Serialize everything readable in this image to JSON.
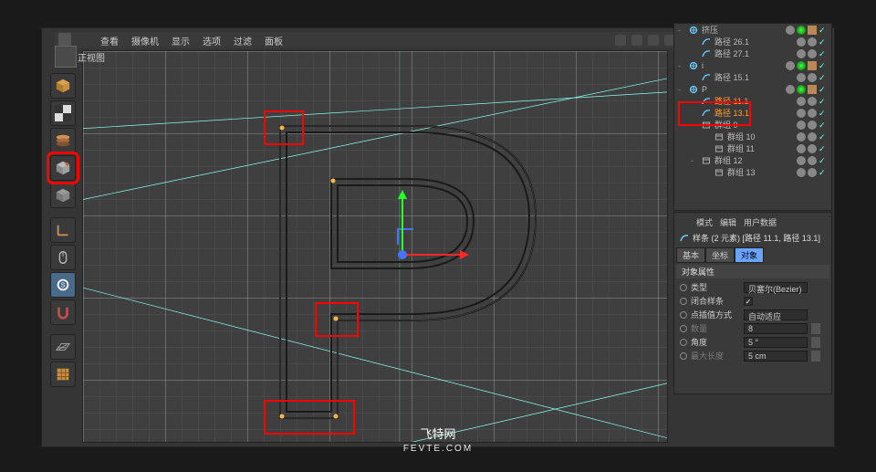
{
  "menu": {
    "items": [
      "查看",
      "摄像机",
      "显示",
      "选项",
      "过滤",
      "面板"
    ]
  },
  "view": {
    "title": "正视图"
  },
  "object_manager": {
    "rows": [
      {
        "lv": 0,
        "toggle": "-",
        "icon": "null",
        "name": "挤压",
        "tags": "full"
      },
      {
        "lv": 1,
        "toggle": "",
        "icon": "spline",
        "name": "路径 26.1",
        "tags": "vis"
      },
      {
        "lv": 1,
        "toggle": "",
        "icon": "spline",
        "name": "路径 27.1",
        "tags": "vis"
      },
      {
        "lv": 0,
        "toggle": "-",
        "icon": "null",
        "name": "i",
        "tags": "full"
      },
      {
        "lv": 1,
        "toggle": "",
        "icon": "spline",
        "name": "路径 15.1",
        "tags": "vis"
      },
      {
        "lv": 0,
        "toggle": "-",
        "icon": "null",
        "name": "P",
        "tags": "full"
      },
      {
        "lv": 1,
        "toggle": "",
        "icon": "spline",
        "name": "路径 11.1",
        "sel": true,
        "tags": "vis"
      },
      {
        "lv": 1,
        "toggle": "",
        "icon": "spline",
        "name": "路径 13.1",
        "sel": true,
        "tags": "vis"
      },
      {
        "lv": 1,
        "toggle": "-",
        "icon": "group",
        "name": "群组 9",
        "tags": "vis"
      },
      {
        "lv": 2,
        "toggle": "",
        "icon": "group",
        "name": "群组 10",
        "tags": "vis"
      },
      {
        "lv": 2,
        "toggle": "",
        "icon": "group",
        "name": "群组 11",
        "tags": "vis"
      },
      {
        "lv": 1,
        "toggle": "-",
        "icon": "group",
        "name": "群组 12",
        "tags": "vis"
      },
      {
        "lv": 2,
        "toggle": "",
        "icon": "group",
        "name": "群组 13",
        "tags": "vis"
      }
    ]
  },
  "attr": {
    "tabs": {
      "mode": "模式",
      "edit": "编辑",
      "userdata": "用户数据"
    },
    "title": "样条 (2 元素) [路径 11.1, 路径 13.1]",
    "subtabs": {
      "basic": "基本",
      "coord": "坐标",
      "object": "对象"
    },
    "section": "对象属性",
    "rows": {
      "type": {
        "label": "类型",
        "value": "贝塞尔(Bezier)"
      },
      "closed": {
        "label": "闭合样条"
      },
      "interp": {
        "label": "点插值方式",
        "value": "自动适应"
      },
      "count": {
        "label": "数量",
        "value": "8"
      },
      "angle": {
        "label": "角度",
        "value": "5 °"
      },
      "maxlen": {
        "label": "最大长度",
        "value": "5 cm"
      }
    }
  },
  "watermark": {
    "title": "飞特网",
    "url": "FEVTE.COM"
  }
}
